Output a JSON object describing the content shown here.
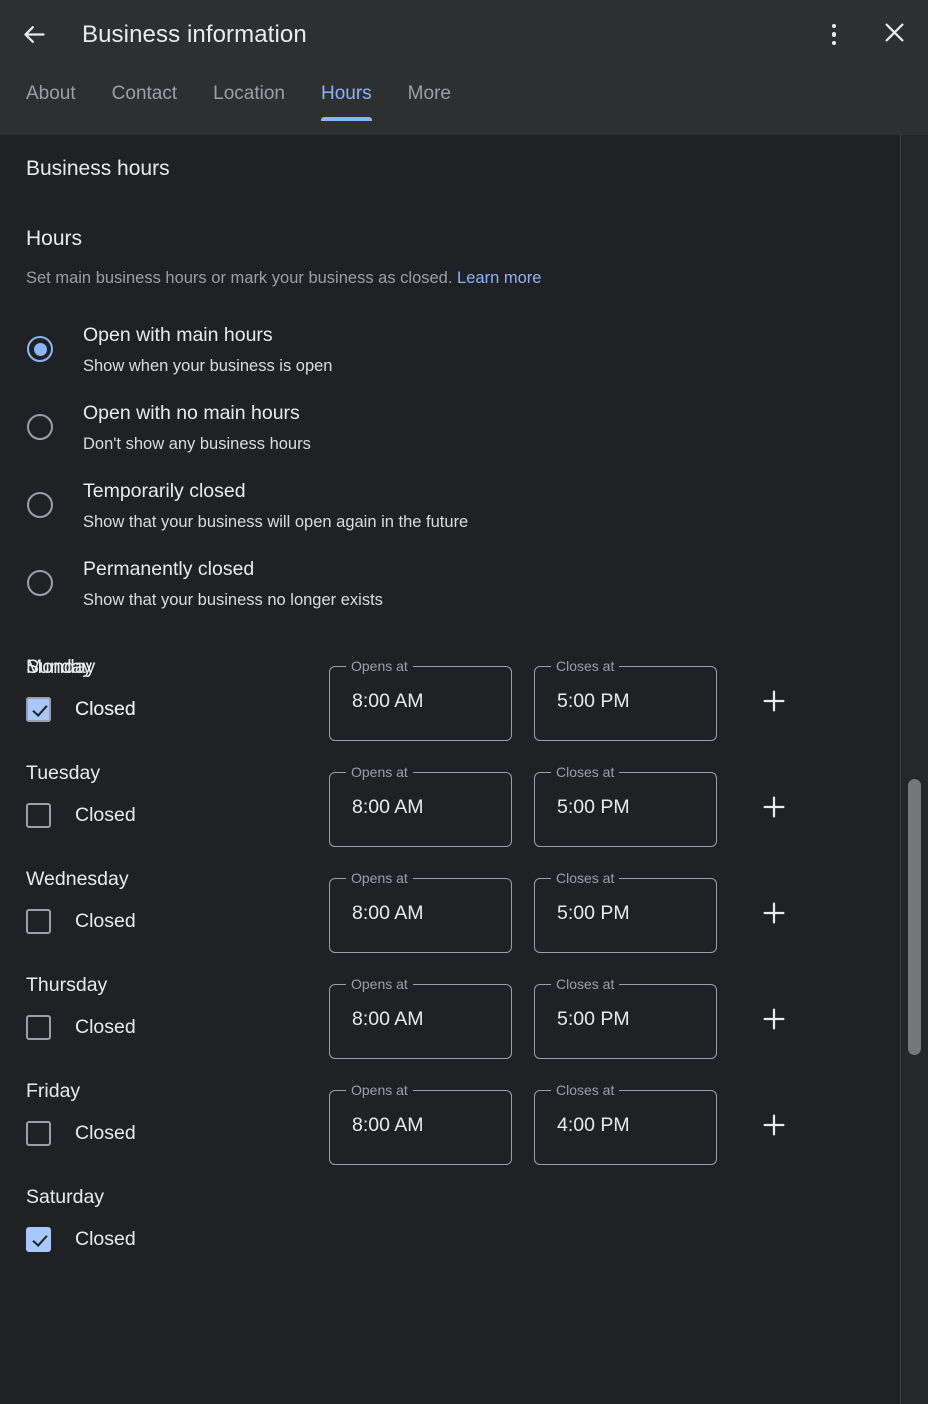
{
  "colors": {
    "header_bg": "#2d2f31",
    "content_bg": "#202124",
    "accent": "#8ab4f8",
    "checkbox_fill": "#a8c7fa",
    "text_primary": "#e8eaed",
    "text_secondary": "#9aa0a6",
    "scrollbar_thumb": "#757779"
  },
  "header": {
    "back_icon": "arrow-back-icon",
    "title": "Business information",
    "overflow_icon": "more-vert-icon",
    "close_icon": "close-icon"
  },
  "tabs": [
    {
      "label": "About",
      "active": false
    },
    {
      "label": "Contact",
      "active": false
    },
    {
      "label": "Location",
      "active": false
    },
    {
      "label": "Hours",
      "active": true
    },
    {
      "label": "More",
      "active": false
    }
  ],
  "main": {
    "section_title": "Business hours",
    "hours_title": "Hours",
    "description": "Set main business hours or mark your business as closed.",
    "learn_more": "Learn more"
  },
  "hours_options": [
    {
      "label": "Open with main hours",
      "sublabel": "Show when your business is open",
      "selected": true
    },
    {
      "label": "Open with no main hours",
      "sublabel": "Don't show any business hours",
      "selected": false
    },
    {
      "label": "Temporarily closed",
      "sublabel": "Show that your business will open again in the future",
      "selected": false
    },
    {
      "label": "Permanently closed",
      "sublabel": "Show that your business no longer exists",
      "selected": false
    }
  ],
  "field_labels": {
    "opens_at": "Opens at",
    "closes_at": "Closes at",
    "closed": "Closed",
    "add_icon": "add-icon"
  },
  "days": [
    {
      "name": "Sunday",
      "closed": true,
      "opens_at": "",
      "closes_at": "",
      "has_times": false
    },
    {
      "name": "Monday",
      "closed": false,
      "opens_at": "8:00 AM",
      "closes_at": "5:00 PM",
      "has_times": true
    },
    {
      "name": "Tuesday",
      "closed": false,
      "opens_at": "8:00 AM",
      "closes_at": "5:00 PM",
      "has_times": true
    },
    {
      "name": "Wednesday",
      "closed": false,
      "opens_at": "8:00 AM",
      "closes_at": "5:00 PM",
      "has_times": true
    },
    {
      "name": "Thursday",
      "closed": false,
      "opens_at": "8:00 AM",
      "closes_at": "5:00 PM",
      "has_times": true
    },
    {
      "name": "Friday",
      "closed": false,
      "opens_at": "8:00 AM",
      "closes_at": "4:00 PM",
      "has_times": true
    },
    {
      "name": "Saturday",
      "closed": true,
      "opens_at": "",
      "closes_at": "",
      "has_times": false
    }
  ]
}
